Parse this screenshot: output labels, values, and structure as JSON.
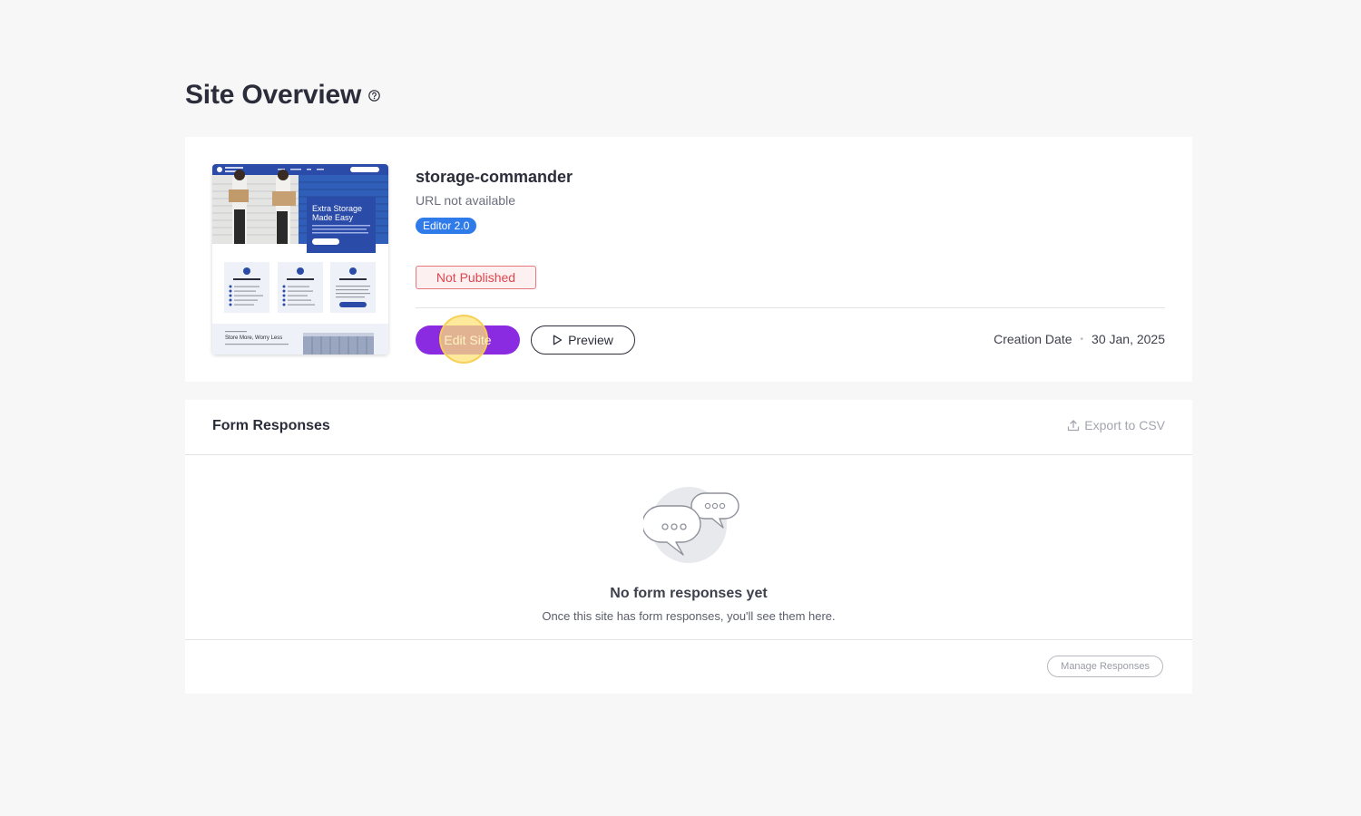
{
  "page": {
    "title": "Site Overview",
    "help_icon": "question-circle-icon"
  },
  "site": {
    "name": "storage-commander",
    "url_text": "URL not available",
    "editor_badge": "Editor 2.0",
    "status": "Not Published",
    "edit_label": "Edit Site",
    "preview_label": "Preview",
    "creation_label": "Creation Date",
    "creation_date": "30 Jan, 2025",
    "thumbnail": {
      "hero_heading": "Extra Storage Made Easy",
      "feature_1": "Convenient For You",
      "feature_2": "Secure Facility",
      "feature_3": "Multiple Unit Sizes",
      "bottom_heading": "Store More, Worry Less"
    }
  },
  "forms": {
    "title": "Form Responses",
    "export_label": "Export to CSV",
    "empty_title": "No form responses yet",
    "empty_subtitle": "Once this site has form responses, you'll see them here.",
    "manage_label": "Manage Responses"
  },
  "colors": {
    "accent": "#8a2be2",
    "badge_blue": "#2f7bea",
    "status_red": "#e0464f",
    "thumb_blue": "#2b4ba8"
  }
}
